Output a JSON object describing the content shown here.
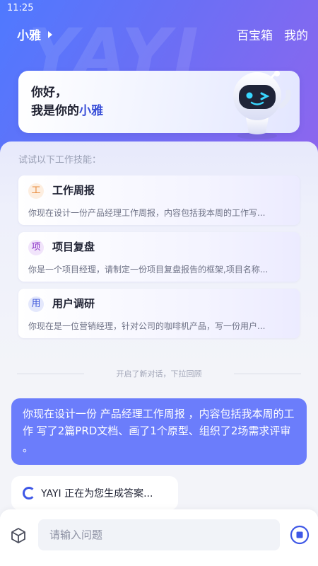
{
  "status": {
    "time": "11:25"
  },
  "nav": {
    "title": "小雅",
    "toolbox": "百宝箱",
    "mine": "我的"
  },
  "hero": {
    "watermark": "YAYI"
  },
  "greeting": {
    "line1": "你好，",
    "line2_prefix": "我是你的",
    "line2_accent": "小雅"
  },
  "skills": {
    "label": "试试以下工作技能：",
    "items": [
      {
        "badge": "工",
        "badge_color": "#e8893a",
        "badge_bg": "#fdeee0",
        "title": "工作周报",
        "desc": "你现在设计一份产品经理工作周报，内容包括我本周的工作写..."
      },
      {
        "badge": "项",
        "badge_color": "#8a2fc7",
        "badge_bg": "#f1e4fb",
        "title": "项目复盘",
        "desc": "你是一个项目经理，请制定一份项目复盘报告的框架,项目名称..."
      },
      {
        "badge": "用",
        "badge_color": "#3b55d9",
        "badge_bg": "#e4e8fc",
        "title": "用户调研",
        "desc": "你现在是一位营销经理，针对公司的咖啡机产品，写一份用户..."
      }
    ]
  },
  "divider": "开启了新对话，下拉回顾",
  "chat": {
    "user_message": "你现在设计一份 产品经理工作周报 ，内容包括我本周的工作 写了2篇PRD文档、画了1个原型、组织了2场需求评审 。",
    "bot_status": "YAYI 正在为您生成答案..."
  },
  "input": {
    "placeholder": "请输入问题"
  },
  "colors": {
    "accent": "#3e57e6",
    "user_bubble": "#6b7dfb",
    "hero_start": "#4f79ff",
    "hero_end": "#8d66ee"
  }
}
